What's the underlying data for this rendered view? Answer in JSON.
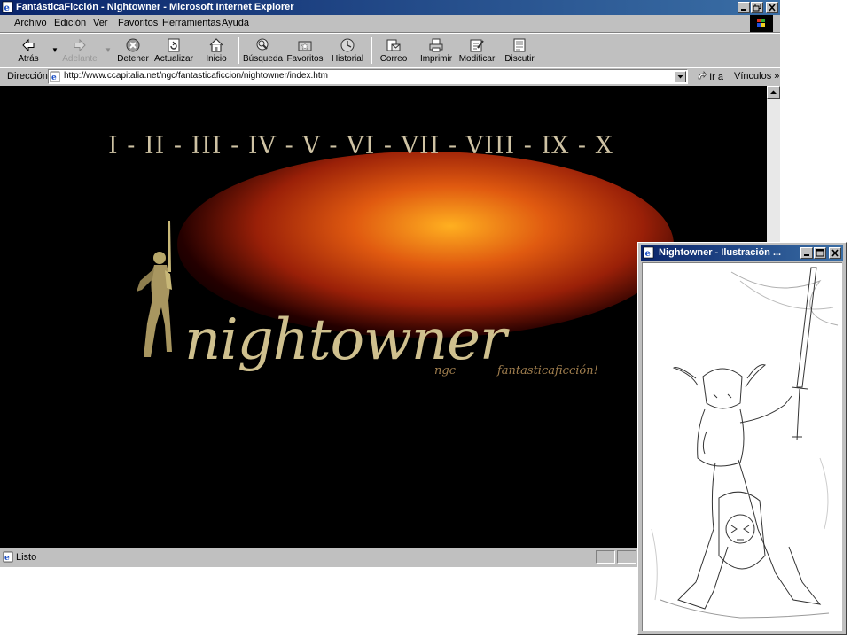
{
  "browser": {
    "title": "FantásticaFicción - Nightowner - Microsoft Internet Explorer",
    "menu": [
      "Archivo",
      "Edición",
      "Ver",
      "Favoritos",
      "Herramientas",
      "Ayuda"
    ],
    "toolbar": {
      "back": "Atrás",
      "forward": "Adelante",
      "stop": "Detener",
      "refresh": "Actualizar",
      "home": "Inicio",
      "search": "Búsqueda",
      "favorites": "Favoritos",
      "history": "Historial",
      "mail": "Correo",
      "print": "Imprimir",
      "edit": "Modificar",
      "discuss": "Discutir"
    },
    "address": {
      "label": "Dirección",
      "url": "http://www.ccapitalia.net/ngc/fantasticaficcion/nightowner/index.htm",
      "go": "Ir a",
      "links": "Vínculos"
    },
    "status": "Listo"
  },
  "page": {
    "numerals": "I - II - III - IV - V - VI - VII - VIII - IX - X",
    "logo": "nightowner",
    "tag_left": "ngc",
    "tag_right": "fantasticaficción!"
  },
  "popup": {
    "title": "Nightowner - Ilustración ..."
  },
  "icons": [
    "ie-page-icon",
    "minimize-icon",
    "restore-icon",
    "close-icon",
    "back-arrow-icon",
    "forward-arrow-icon",
    "stop-icon",
    "refresh-icon",
    "home-icon",
    "search-icon",
    "favorites-icon",
    "history-icon",
    "mail-icon",
    "print-icon",
    "edit-icon",
    "discuss-icon",
    "go-arrow-icon",
    "windows-logo-icon"
  ]
}
